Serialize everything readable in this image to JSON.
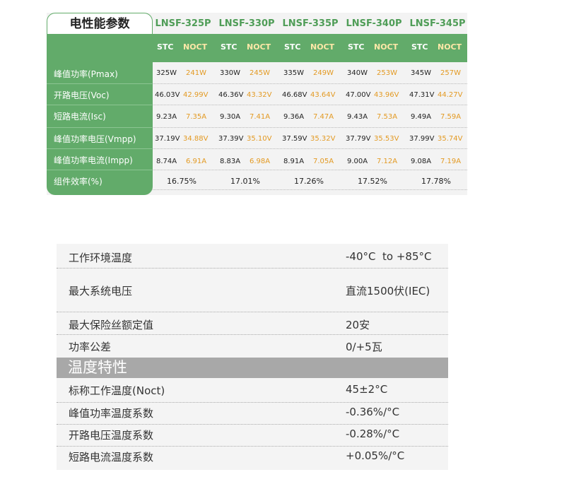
{
  "electrical": {
    "title": "电性能参数",
    "models": [
      "LNSF-325P",
      "LNSF-330P",
      "LNSF-335P",
      "LNSF-340P",
      "LNSF-345P"
    ],
    "stc": "STC",
    "noct": "NOCT",
    "rows": [
      {
        "label": "峰值功率(Pmax)",
        "values": [
          [
            "325W",
            "241W"
          ],
          [
            "330W",
            "245W"
          ],
          [
            "335W",
            "249W"
          ],
          [
            "340W",
            "253W"
          ],
          [
            "345W",
            "257W"
          ]
        ]
      },
      {
        "label": "开路电压(Voc)",
        "values": [
          [
            "46.03V",
            "42.99V"
          ],
          [
            "46.36V",
            "43.32V"
          ],
          [
            "46.68V",
            "43.64V"
          ],
          [
            "47.00V",
            "43.96V"
          ],
          [
            "47.31V",
            "44.27V"
          ]
        ]
      },
      {
        "label": "短路电流(Isc)",
        "values": [
          [
            "9.23A",
            "7.35A"
          ],
          [
            "9.30A",
            "7.41A"
          ],
          [
            "9.36A",
            "7.47A"
          ],
          [
            "9.43A",
            "7.53A"
          ],
          [
            "9.49A",
            "7.59A"
          ]
        ]
      },
      {
        "label": "峰值功率电压(Vmpp)",
        "values": [
          [
            "37.19V",
            "34.88V"
          ],
          [
            "37.39V",
            "35.10V"
          ],
          [
            "37.59V",
            "35.32V"
          ],
          [
            "37.79V",
            "35.53V"
          ],
          [
            "37.99V",
            "35.74V"
          ]
        ]
      },
      {
        "label": "峰值功率电流(Impp)",
        "values": [
          [
            "8.74A",
            "6.91A"
          ],
          [
            "8.83A",
            "6.98A"
          ],
          [
            "8.91A",
            "7.05A"
          ],
          [
            "9.00A",
            "7.12A"
          ],
          [
            "9.08A",
            "7.19A"
          ]
        ]
      }
    ],
    "efficiency": {
      "label": "组件效率(%)",
      "values": [
        "16.75%",
        "17.01%",
        "17.26%",
        "17.52%",
        "17.78%"
      ]
    }
  },
  "operating": {
    "rows": [
      {
        "label": "工作环境温度",
        "value": "-40°C  to +85°C"
      },
      {
        "label": "最大系统电压",
        "value": "直流1500伏(IEC)"
      },
      {
        "label": "最大保险丝额定值",
        "value": "20安"
      },
      {
        "label": "功率公差",
        "value": "0/+5瓦"
      }
    ],
    "temperature_title": "温度特性",
    "temperature_rows": [
      {
        "label": "标称工作温度(Noct)",
        "value": "45±2°C"
      },
      {
        "label": "峰值功率温度系数",
        "value": "-0.36%/°C"
      },
      {
        "label": "开路电压温度系数",
        "value": "-0.28%/°C"
      },
      {
        "label": "短路电流温度系数",
        "value": "+0.05%/°C"
      }
    ]
  }
}
